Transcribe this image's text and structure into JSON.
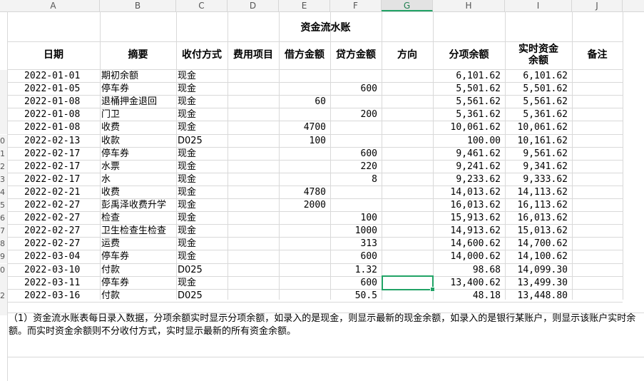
{
  "columns": [
    "A",
    "B",
    "C",
    "D",
    "E",
    "F",
    "G",
    "H",
    "I",
    "J"
  ],
  "selected_column": "G",
  "row_numbers": [
    "",
    "",
    "",
    "",
    "",
    "",
    "",
    "",
    "",
    "0",
    "1",
    "2",
    "3",
    "4",
    "5",
    "6",
    "7",
    "8",
    "9",
    "0",
    "",
    "2",
    ""
  ],
  "sheet": {
    "title": "资金流水账",
    "headers": [
      "日期",
      "摘要",
      "收付方式",
      "费用项目",
      "借方金额",
      "贷方金额",
      "方向",
      "分项余额",
      "实时资金余额",
      "备注"
    ],
    "rows": [
      [
        "2022-01-01",
        "期初余额",
        "现金",
        "",
        "",
        "",
        "",
        "6,101.62",
        "6,101.62",
        ""
      ],
      [
        "2022-01-05",
        "停车券",
        "现金",
        "",
        "",
        "600",
        "",
        "5,501.62",
        "5,501.62",
        ""
      ],
      [
        "2022-01-08",
        "退桶押金退回",
        "现金",
        "",
        "60",
        "",
        "",
        "5,561.62",
        "5,561.62",
        ""
      ],
      [
        "2022-01-08",
        "门卫",
        "现金",
        "",
        "",
        "200",
        "",
        "5,361.62",
        "5,361.62",
        ""
      ],
      [
        "2022-01-08",
        "收费",
        "现金",
        "",
        "4700",
        "",
        "",
        "10,061.62",
        "10,061.62",
        ""
      ],
      [
        "2022-02-13",
        "收款",
        "D025",
        "",
        "100",
        "",
        "",
        "100.00",
        "10,161.62",
        ""
      ],
      [
        "2022-02-17",
        "停车券",
        "现金",
        "",
        "",
        "600",
        "",
        "9,461.62",
        "9,561.62",
        ""
      ],
      [
        "2022-02-17",
        "水票",
        "现金",
        "",
        "",
        "220",
        "",
        "9,241.62",
        "9,341.62",
        ""
      ],
      [
        "2022-02-17",
        "水",
        "现金",
        "",
        "",
        "8",
        "",
        "9,233.62",
        "9,333.62",
        ""
      ],
      [
        "2022-02-21",
        "收费",
        "现金",
        "",
        "4780",
        "",
        "",
        "14,013.62",
        "14,113.62",
        ""
      ],
      [
        "2022-02-27",
        "彭禹泽收费升学",
        "现金",
        "",
        "2000",
        "",
        "",
        "16,013.62",
        "16,113.62",
        ""
      ],
      [
        "2022-02-27",
        "检查",
        "现金",
        "",
        "",
        "100",
        "",
        "15,913.62",
        "16,013.62",
        ""
      ],
      [
        "2022-02-27",
        "卫生检查生检查",
        "现金",
        "",
        "",
        "1000",
        "",
        "14,913.62",
        "15,013.62",
        ""
      ],
      [
        "2022-02-27",
        "运费",
        "现金",
        "",
        "",
        "313",
        "",
        "14,600.62",
        "14,700.62",
        ""
      ],
      [
        "2022-03-04",
        "停车券",
        "现金",
        "",
        "",
        "600",
        "",
        "14,000.62",
        "14,100.62",
        ""
      ],
      [
        "2022-03-10",
        "付款",
        "D025",
        "",
        "",
        "1.32",
        "",
        "98.68",
        "14,099.30",
        ""
      ],
      [
        "2022-03-11",
        "停车券",
        "现金",
        "",
        "",
        "600",
        "",
        "13,400.62",
        "13,499.30",
        ""
      ],
      [
        "2022-03-16",
        "付款",
        "D025",
        "",
        "",
        "50.5",
        "",
        "48.18",
        "13,448.80",
        ""
      ]
    ],
    "note": "（1）资金流水账表每日录入数据，分项余额实时显示分项余额，如录入的是现金，则显示最新的现金余额，如录入的是银行某账户，则显示该账户实时余额。而实时资金余额则不分收付方式，实时显示最新的所有资金余额。"
  }
}
